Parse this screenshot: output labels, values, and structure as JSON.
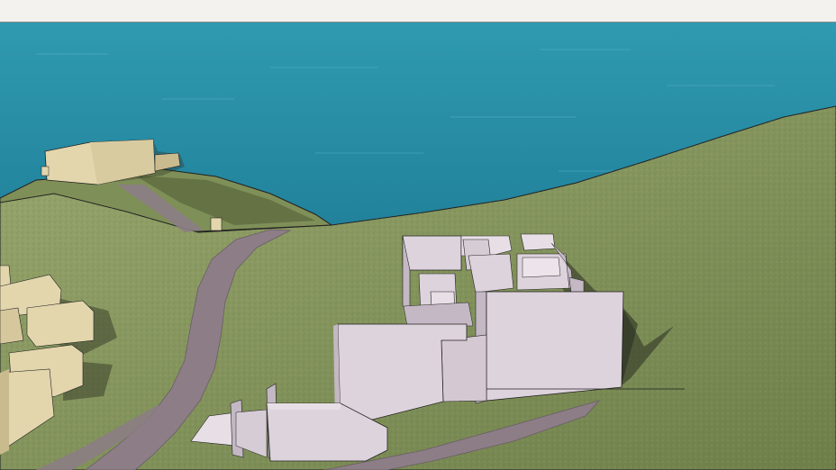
{
  "scene": {
    "type": "3d-model-viewport",
    "colors": {
      "sky": "#f4f2ee",
      "sea_far": "#2f9ab0",
      "sea_near": "#1f7e98",
      "grass_light": "#98a86e",
      "grass_dark": "#6f7f4a",
      "path": "#8c7d86",
      "building_mass": "#e3d6ad",
      "building_mass_shade": "#c9bb8e",
      "proposed_building": "#ddd3dc",
      "proposed_building_shade": "#c3b8c3",
      "outline": "#222222",
      "shadow": "#2a2f22"
    }
  }
}
